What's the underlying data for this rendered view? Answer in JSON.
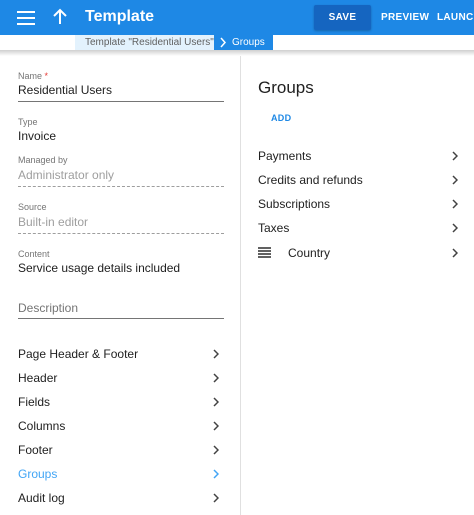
{
  "app_bar": {
    "title": "Template",
    "actions": {
      "save": "SAVE",
      "preview": "PREVIEW",
      "launch": "LAUNCH"
    }
  },
  "breadcrumb": {
    "parent": "Template \"Residential Users\"",
    "current": "Groups"
  },
  "form": {
    "name": {
      "label": "Name",
      "required_mark": "*",
      "value": "Residential Users"
    },
    "type": {
      "label": "Type",
      "value": "Invoice"
    },
    "managed_by": {
      "label": "Managed by",
      "value": "Administrator only"
    },
    "source": {
      "label": "Source",
      "value": "Built-in editor"
    },
    "content": {
      "label": "Content",
      "value": "Service usage details included"
    },
    "description": {
      "placeholder": "Description"
    }
  },
  "nav": {
    "items": [
      {
        "label": "Page Header & Footer"
      },
      {
        "label": "Header"
      },
      {
        "label": "Fields"
      },
      {
        "label": "Columns"
      },
      {
        "label": "Footer"
      },
      {
        "label": "Groups",
        "active": true
      },
      {
        "label": "Audit log"
      }
    ]
  },
  "groups": {
    "title": "Groups",
    "add_label": "ADD",
    "items": [
      {
        "label": "Payments"
      },
      {
        "label": "Credits and refunds"
      },
      {
        "label": "Subscriptions"
      },
      {
        "label": "Taxes"
      },
      {
        "label": "Country",
        "draggable": true
      }
    ]
  },
  "colors": {
    "primary": "#1e88e5",
    "primary_dark": "#1565c0",
    "active_link": "#42a5f5",
    "crumb_bg": "#e3f2fd"
  },
  "icons": {
    "menu": "menu-icon",
    "back": "arrow-up-icon",
    "chevron": "chevron-right-icon",
    "drag": "drag-handle-icon"
  }
}
